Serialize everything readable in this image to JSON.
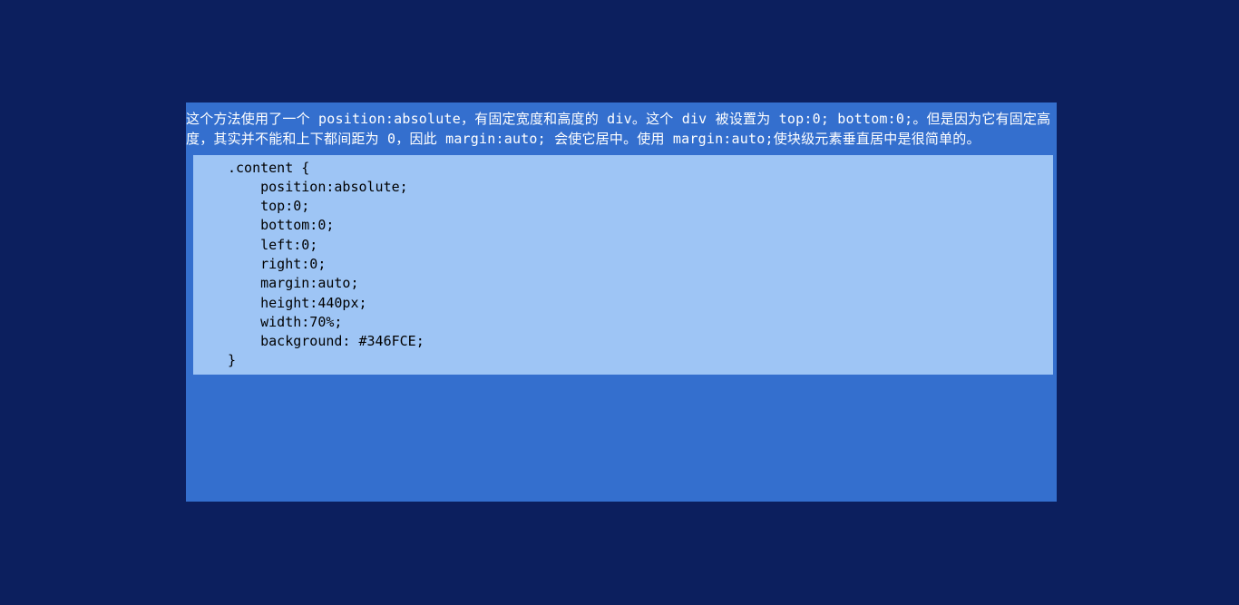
{
  "content": {
    "description": "这个方法使用了一个 position:absolute，有固定宽度和高度的 div。这个 div 被设置为 top:0; bottom:0;。但是因为它有固定高度，其实并不能和上下都间距为 0，因此 margin:auto; 会使它居中。使用 margin:auto;使块级元素垂直居中是很简单的。",
    "code": ".content {\n    position:absolute;\n    top:0;\n    bottom:0;\n    left:0;\n    right:0;\n    margin:auto;\n    height:440px;\n    width:70%;\n    background: #346FCE;\n}"
  }
}
